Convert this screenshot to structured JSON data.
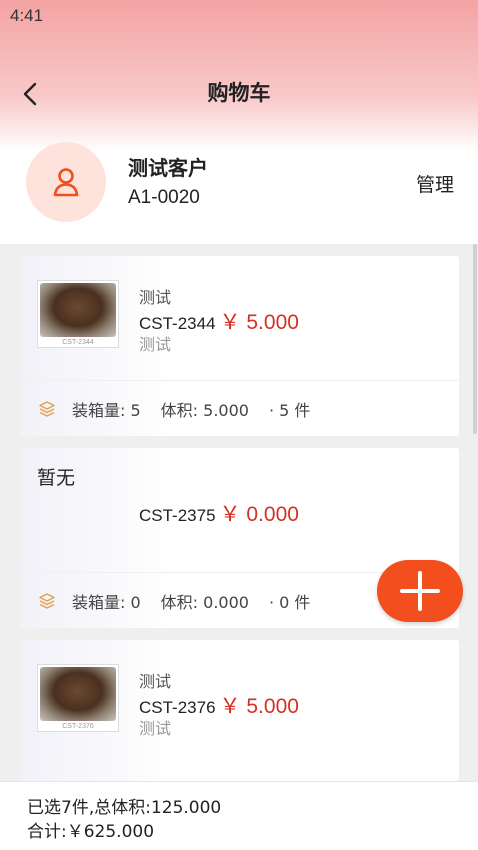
{
  "status_bar": {
    "time": "4:41"
  },
  "header": {
    "title": "购物车"
  },
  "customer": {
    "name": "测试客户",
    "code": "A1-0020",
    "manage_label": "管理"
  },
  "items": [
    {
      "name": "测试",
      "code": "CST-2344",
      "price": "￥ 5.000",
      "sub": "测试",
      "image_caption": "CST-2344",
      "packing": "装箱量: 5",
      "volume": "体积: 5.000",
      "count": "· 5 件"
    },
    {
      "no_image_text": "暂无",
      "code": "CST-2375",
      "price": "￥ 0.000",
      "packing": "装箱量: 0",
      "volume": "体积: 0.000",
      "count": "· 0 件"
    },
    {
      "name": "测试",
      "code": "CST-2376",
      "price": "￥ 5.000",
      "sub": "测试",
      "image_caption": "CST-2376"
    }
  ],
  "summary": {
    "selected": "已选7件,总体积:125.000",
    "total": "合计:￥625.000"
  },
  "icons": {
    "back": "chevron-left-icon",
    "avatar": "person-icon",
    "packing": "layers-icon",
    "fab": "plus-icon"
  },
  "colors": {
    "accent": "#f24e1e",
    "price": "#d23226",
    "header_gradient_top": "#f4a3a3",
    "avatar_bg": "#fde3dc"
  }
}
